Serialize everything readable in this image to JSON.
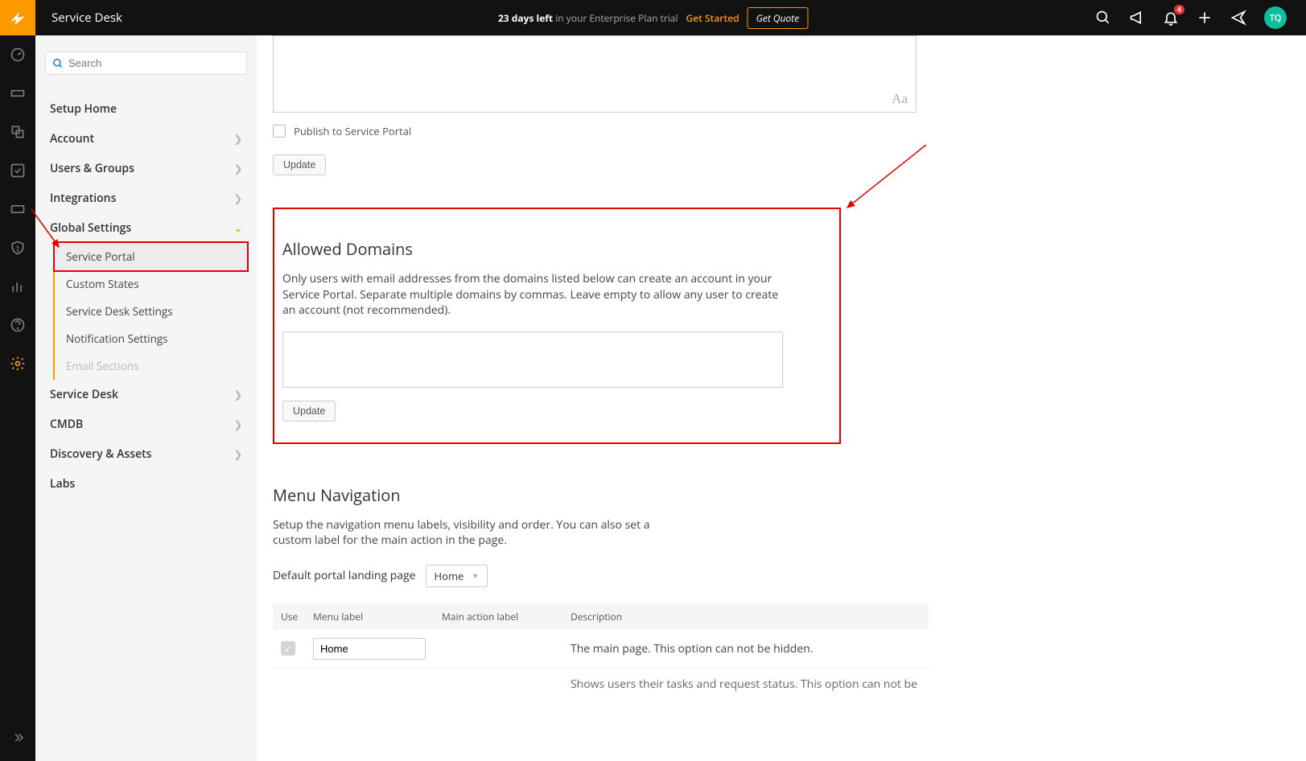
{
  "header": {
    "app_title": "Service Desk",
    "trial_days": "23 days left",
    "trial_rest": " in your Enterprise Plan trial",
    "get_started": "Get Started",
    "get_quote": "Get Quote",
    "notif_count": "4",
    "avatar_initials": "TQ"
  },
  "sidebar": {
    "search_placeholder": "Search",
    "items": [
      {
        "label": "Setup Home",
        "chev": false
      },
      {
        "label": "Account",
        "chev": true
      },
      {
        "label": "Users & Groups",
        "chev": true
      },
      {
        "label": "Integrations",
        "chev": true
      },
      {
        "label": "Global Settings",
        "chev": true,
        "expanded": true
      },
      {
        "label": "Service Desk",
        "chev": true
      },
      {
        "label": "CMDB",
        "chev": true
      },
      {
        "label": "Discovery & Assets",
        "chev": true
      },
      {
        "label": "Labs",
        "chev": false
      }
    ],
    "global_sub": [
      {
        "label": "Service Portal",
        "active": true
      },
      {
        "label": "Custom States"
      },
      {
        "label": "Service Desk Settings"
      },
      {
        "label": "Notification Settings"
      },
      {
        "label": "Email Sections",
        "disabled": true
      }
    ]
  },
  "content": {
    "aa_glyph": "Aa",
    "publish_label": "Publish to Service Portal",
    "update_btn": "Update",
    "allowed_domains_title": "Allowed Domains",
    "allowed_domains_desc": "Only users with email addresses from the domains listed below can create an account in your Service Portal. Separate multiple domains by commas. Leave empty to allow any user to create an account (not recommended).",
    "update_btn2": "Update",
    "menu_nav_title": "Menu Navigation",
    "menu_nav_desc": "Setup the navigation menu labels, visibility and order. You can also set a custom label for the main action in the page.",
    "landing_label": "Default portal landing page",
    "landing_value": "Home",
    "th_use": "Use",
    "th_menu": "Menu label",
    "th_main": "Main action label",
    "th_desc": "Description",
    "row1_input": "Home",
    "row1_desc": "The main page. This option can not be hidden.",
    "row2_desc": "Shows users their tasks and request status. This option can not be"
  }
}
